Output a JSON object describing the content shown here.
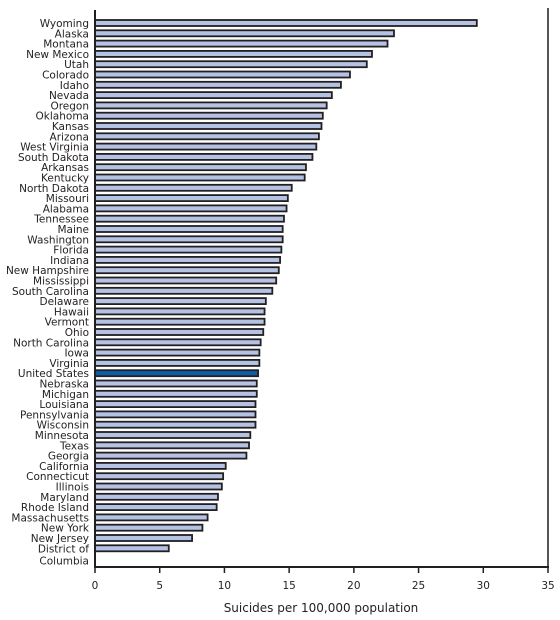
{
  "chart_data": {
    "type": "bar",
    "orientation": "horizontal",
    "title": "",
    "xlabel": "Suicides per 100,000 population",
    "ylabel": "",
    "xlim": [
      0,
      35
    ],
    "xticks": [
      0,
      5,
      10,
      15,
      20,
      25,
      30,
      35
    ],
    "grid": false,
    "colors": {
      "bar": "#b4c3e4",
      "highlight": "#0a5ea8",
      "outline": "#231f20"
    },
    "highlight_category": "United States",
    "categories": [
      "Wyoming",
      "Alaska",
      "Montana",
      "New Mexico",
      "Utah",
      "Colorado",
      "Idaho",
      "Nevada",
      "Oregon",
      "Oklahoma",
      "Kansas",
      "Arizona",
      "West Virginia",
      "South Dakota",
      "Arkansas",
      "Kentucky",
      "North Dakota",
      "Missouri",
      "Alabama",
      "Tennessee",
      "Maine",
      "Washington",
      "Florida",
      "Indiana",
      "New Hampshire",
      "Mississippi",
      "South Carolina",
      "Delaware",
      "Hawaii",
      "Vermont",
      "Ohio",
      "North Carolina",
      "Iowa",
      "Virginia",
      "United States",
      "Nebraska",
      "Michigan",
      "Louisiana",
      "Pennsylvania",
      "Wisconsin",
      "Minnesota",
      "Texas",
      "Georgia",
      "California",
      "Connecticut",
      "Illinois",
      "Maryland",
      "Rhode Island",
      "Massachusetts",
      "New York",
      "New Jersey",
      "District of Columbia"
    ],
    "values": [
      29.5,
      23.1,
      22.6,
      21.4,
      21.0,
      19.7,
      19.0,
      18.3,
      17.9,
      17.6,
      17.5,
      17.3,
      17.1,
      16.8,
      16.3,
      16.2,
      15.2,
      14.9,
      14.8,
      14.6,
      14.5,
      14.5,
      14.4,
      14.3,
      14.2,
      14.0,
      13.7,
      13.2,
      13.1,
      13.1,
      13.0,
      12.8,
      12.7,
      12.7,
      12.6,
      12.5,
      12.5,
      12.4,
      12.4,
      12.4,
      12.0,
      11.9,
      11.7,
      10.1,
      9.9,
      9.8,
      9.5,
      9.4,
      8.7,
      8.3,
      7.5,
      5.7
    ]
  }
}
